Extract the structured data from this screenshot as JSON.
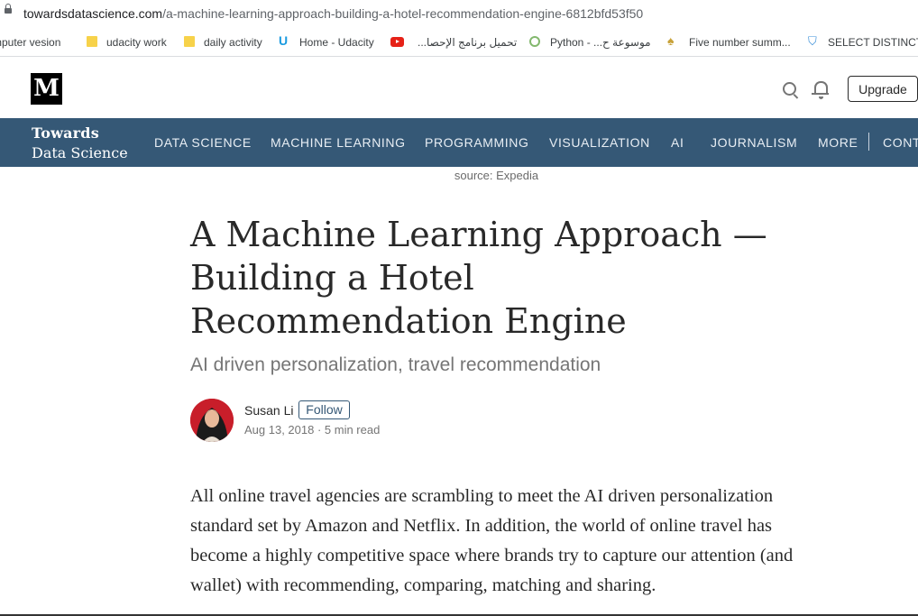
{
  "browser": {
    "url_host": "towardsdatascience.com",
    "url_path": "/a-machine-learning-approach-building-a-hotel-recommendation-engine-6812bfd53f50",
    "bookmarks": [
      {
        "label": "mputer vesion",
        "icon": "none"
      },
      {
        "label": "udacity work",
        "icon": "folder-icon"
      },
      {
        "label": "daily activity",
        "icon": "folder-icon"
      },
      {
        "label": "Home - Udacity",
        "icon": "udacity-icon"
      },
      {
        "label": "تحميل برنامج الإحصا...",
        "icon": "youtube-icon"
      },
      {
        "label": "Python - ...موسوعة ح",
        "icon": "python-icon"
      },
      {
        "label": "Five number summ...",
        "icon": "five-number-icon"
      },
      {
        "label": "SELECT DISTINCT |...",
        "icon": "shield-icon"
      }
    ]
  },
  "header": {
    "logo": "M",
    "upgrade_label": "Upgrade"
  },
  "publication": {
    "name_line1": "Towards",
    "name_line2": "Data Science",
    "nav": [
      "DATA SCIENCE",
      "MACHINE LEARNING",
      "PROGRAMMING",
      "VISUALIZATION",
      "AI",
      "JOURNALISM",
      "MORE",
      "CONT"
    ]
  },
  "article": {
    "image_caption": "source: Expedia",
    "title": "A Machine Learning Approach — Building a Hotel Recommendation Engine",
    "subtitle": "AI driven personalization, travel recommendation",
    "author": "Susan Li",
    "follow_label": "Follow",
    "meta": "Aug 13, 2018 · 5 min read",
    "body": "All online travel agencies are scrambling to meet the AI driven personalization standard set by Amazon and Netflix. In addition, the world of online travel has become a highly competitive space where brands try to capture our attention (and wallet) with recommending, comparing, matching and sharing."
  },
  "colors": {
    "nav_bg": "#355876",
    "accent": "#355876"
  }
}
